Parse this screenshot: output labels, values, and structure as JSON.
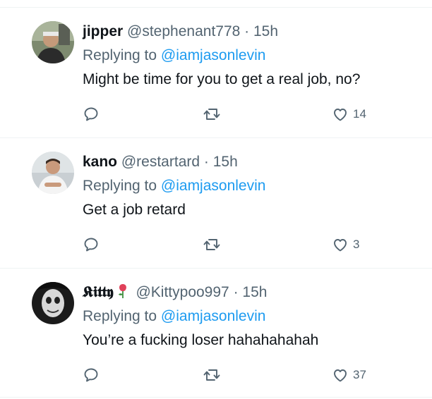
{
  "replies": [
    {
      "display_name": "jipper",
      "handle": "@stephenant778",
      "separator": "·",
      "time": "15h",
      "replying_label": "Replying to",
      "replying_to": "@iamjasonlevin",
      "text": "Might be time for you to get a real job, no?",
      "likes": "14"
    },
    {
      "display_name": "kano",
      "handle": "@restartard",
      "separator": "·",
      "time": "15h",
      "replying_label": "Replying to",
      "replying_to": "@iamjasonlevin",
      "text": "Get a job retard",
      "likes": "3"
    },
    {
      "display_name": "𝕶𝖎𝖙𝖙𝖞",
      "name_emoji": "rose-emoji",
      "handle": "@Kittypoo997",
      "separator": "·",
      "time": "15h",
      "replying_label": "Replying to",
      "replying_to": "@iamjasonlevin",
      "text": "You’re a fucking loser hahahahahah",
      "likes": "37"
    }
  ],
  "icons": [
    "reply-icon",
    "retweet-icon",
    "like-icon"
  ],
  "colors": {
    "text": "#0f1419",
    "secondary": "#536471",
    "link": "#1d9bf0",
    "divider": "#eff3f4"
  }
}
